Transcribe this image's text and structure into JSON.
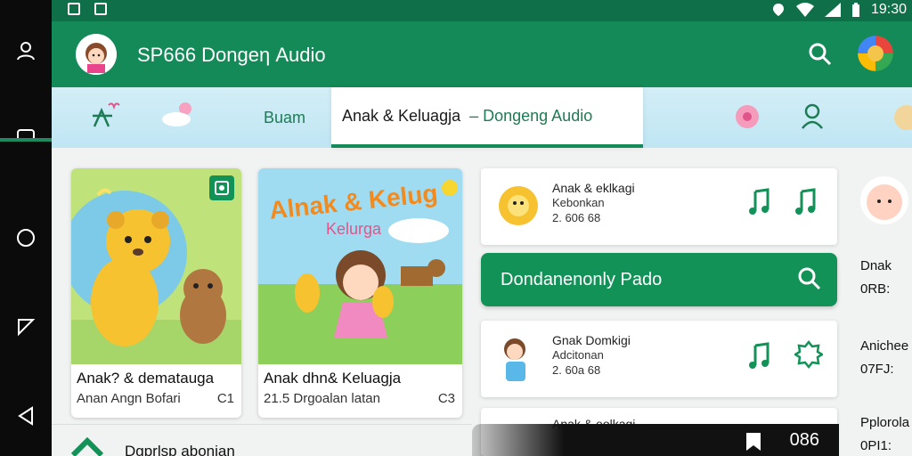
{
  "status_bar": {
    "time": "19:30"
  },
  "app": {
    "title": "SP666  Dongeη Audio"
  },
  "tabs": [
    {
      "label": "Buam"
    },
    {
      "label": "Anak & Keluagja",
      "label2": "– Dongeng Audio"
    }
  ],
  "cards": [
    {
      "title": "Anak? & dematauga",
      "subtitle": "Anan Angn Bofari",
      "badge": "C1"
    },
    {
      "title": "Anak dhn& Keluagja",
      "subtitle": "21.5 Drgoalan latan",
      "badge": "C3",
      "art_text_1": "Alnak & Kelug",
      "art_text_2": "Kelurga"
    }
  ],
  "rows": [
    {
      "title": "Anak & eklkagi",
      "subtitle": "Kebonkan",
      "time": "2. 606 68"
    },
    {
      "title": "Gnak Domkigi",
      "subtitle": "Adcitonan",
      "time": "2. 60a 68"
    },
    {
      "title": "Anak & eolkagi"
    }
  ],
  "green_bar": {
    "label": "Dondanenonly Pado"
  },
  "side_list": [
    {
      "title": "Dnak",
      "value": "0RB:"
    },
    {
      "title": "Anichee",
      "value": "07FJ:"
    },
    {
      "title": "Pplorola",
      "value": "0PI1:"
    }
  ],
  "bottom": {
    "left_text": "Dgprlsp abonian",
    "time": "086"
  },
  "colors": {
    "app_bar": "#138a57",
    "status_bar": "#0f6f48",
    "accent": "#139258",
    "tab_bg": "#cdebf5"
  }
}
